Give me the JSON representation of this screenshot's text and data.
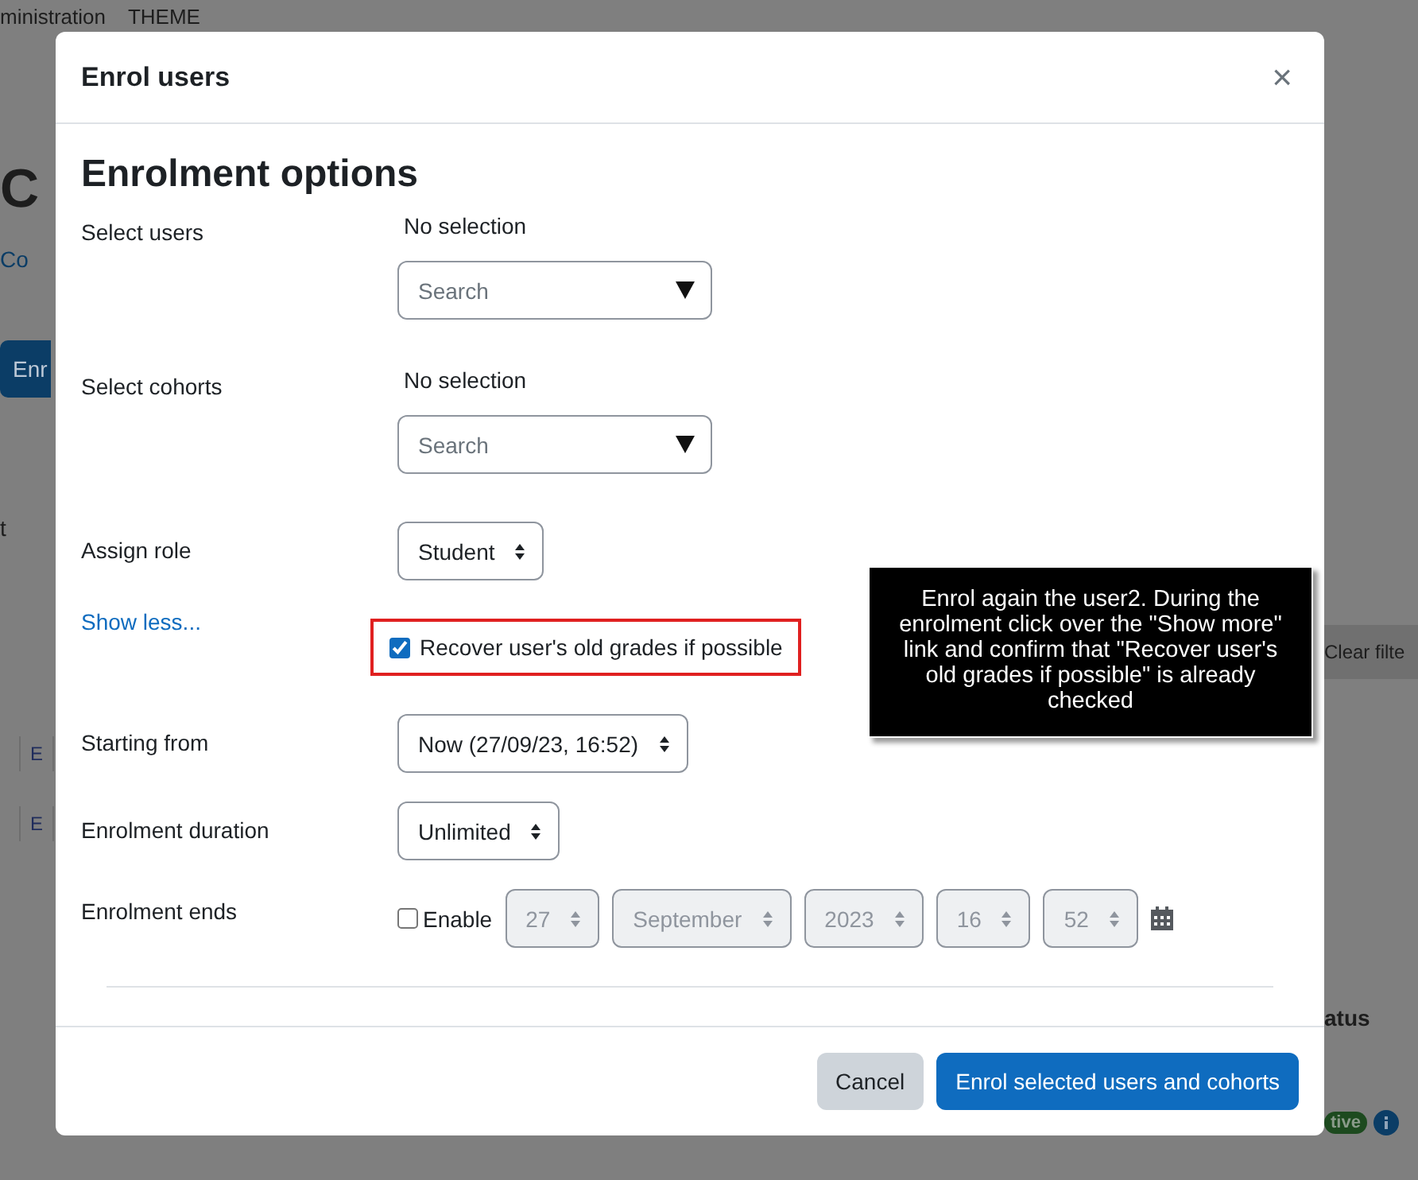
{
  "background": {
    "breadcrumb": [
      "ministration",
      "THEME"
    ],
    "heading": "C",
    "link": "Co",
    "button": "Enr",
    "tab": "t",
    "cells": [
      "E",
      "E"
    ],
    "filter_button": "Clear filte",
    "column_heading": "atus",
    "status_badge": "tive"
  },
  "dialog": {
    "title": "Enrol users",
    "close": "×",
    "heading": "Enrolment options",
    "fields": [
      {
        "kind": "autocomplete",
        "label": "Select users",
        "selection": "No selection",
        "placeholder": "Search"
      },
      {
        "kind": "autocomplete",
        "label": "Select cohorts",
        "selection": "No selection",
        "placeholder": "Search"
      },
      {
        "kind": "select",
        "label": "Assign role",
        "value": "Student",
        "disabled": false
      },
      {
        "kind": "checkbox",
        "link": "Show less...",
        "label": "Recover user's old grades if possible",
        "checked": true,
        "highlighted": true
      },
      {
        "kind": "select",
        "label": "Starting from",
        "value": "Now (27/09/23, 16:52)",
        "disabled": false
      },
      {
        "kind": "select",
        "label": "Enrolment duration",
        "value": "Unlimited",
        "disabled": false
      },
      {
        "kind": "date",
        "label": "Enrolment ends",
        "enable_label": "Enable",
        "checked": false,
        "parts": [
          "27",
          "September",
          "2023",
          "16",
          "52"
        ],
        "disabled": true
      }
    ],
    "buttons": [
      {
        "label": "Cancel",
        "kind": "secondary"
      },
      {
        "label": "Enrol selected users and cohorts",
        "kind": "primary"
      }
    ]
  },
  "note": "Enrol again the user2. During the enrolment click over the \"Show more\" link and confirm that \"Recover user's old grades if possible\" is already checked"
}
